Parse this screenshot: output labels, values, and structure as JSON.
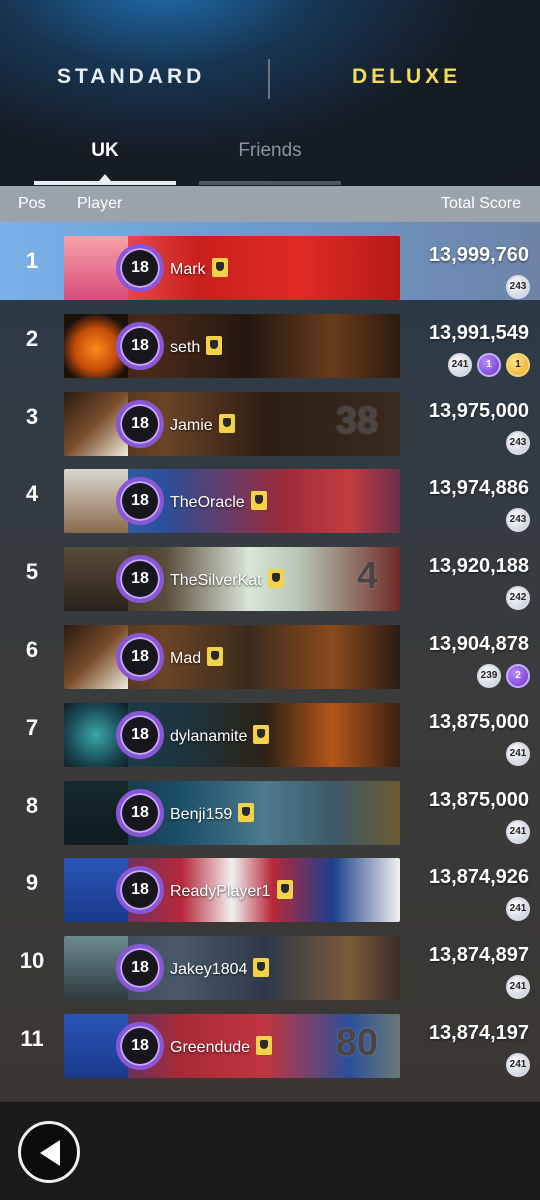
{
  "modes": {
    "standard": "STANDARD",
    "deluxe": "DELUXE"
  },
  "regions": {
    "uk": "UK",
    "friends": "Friends"
  },
  "columns": {
    "pos": "Pos",
    "player": "Player",
    "score": "Total Score"
  },
  "rows": [
    {
      "pos": "1",
      "level": "18",
      "name": "Mark",
      "score": "13,999,760",
      "badges": [
        {
          "v": "243",
          "t": "silver"
        }
      ],
      "highlight": true
    },
    {
      "pos": "2",
      "level": "18",
      "name": "seth",
      "score": "13,991,549",
      "badges": [
        {
          "v": "241",
          "t": "silver"
        },
        {
          "v": "1",
          "t": "purple"
        },
        {
          "v": "1",
          "t": "gold"
        }
      ]
    },
    {
      "pos": "3",
      "level": "18",
      "name": "Jamie",
      "score": "13,975,000",
      "badges": [
        {
          "v": "243",
          "t": "silver"
        }
      ],
      "banner_text": "38"
    },
    {
      "pos": "4",
      "level": "18",
      "name": "TheOracle",
      "score": "13,974,886",
      "badges": [
        {
          "v": "243",
          "t": "silver"
        }
      ]
    },
    {
      "pos": "5",
      "level": "18",
      "name": "TheSilverKat",
      "score": "13,920,188",
      "badges": [
        {
          "v": "242",
          "t": "silver"
        }
      ],
      "banner_text": "4"
    },
    {
      "pos": "6",
      "level": "18",
      "name": "Mad",
      "score": "13,904,878",
      "badges": [
        {
          "v": "239",
          "t": "silver"
        },
        {
          "v": "2",
          "t": "purple"
        }
      ]
    },
    {
      "pos": "7",
      "level": "18",
      "name": "dylanamite",
      "score": "13,875,000",
      "badges": [
        {
          "v": "241",
          "t": "silver"
        }
      ]
    },
    {
      "pos": "8",
      "level": "18",
      "name": "Benji159",
      "score": "13,875,000",
      "badges": [
        {
          "v": "241",
          "t": "silver"
        }
      ]
    },
    {
      "pos": "9",
      "level": "18",
      "name": "ReadyPlayer1",
      "score": "13,874,926",
      "badges": [
        {
          "v": "241",
          "t": "silver"
        }
      ]
    },
    {
      "pos": "10",
      "level": "18",
      "name": "Jakey1804",
      "score": "13,874,897",
      "badges": [
        {
          "v": "241",
          "t": "silver"
        }
      ]
    },
    {
      "pos": "11",
      "level": "18",
      "name": "Greendude",
      "score": "13,874,197",
      "badges": [
        {
          "v": "241",
          "t": "silver"
        }
      ],
      "banner_text": "80"
    }
  ],
  "banner_styles": [
    "linear-gradient(90deg,#e5736f 0%,#e9484c 18%,#c8201c 40%,#e02a26 70%,#b51a17 100%)",
    "linear-gradient(90deg,#2a1a12 0%,#4a2b18 25%,#231711 55%,#6a3b1a 80%,#2a1a12 100%)",
    "linear-gradient(90deg,#3a2516 0%,#6b4426 30%,#2b1e14 60%,#3b2a1e 100%)",
    "linear-gradient(90deg,#3c6fb0 0%,#2b4f9a 30%,#9b2b3b 65%,#c23c40 85%,#6a2f4a 100%)",
    "linear-gradient(90deg,#2e2922 0%,#5a4c3a 30%,#d9e6d8 55%,#b7c6b6 70%,#6e2a24 100%)",
    "linear-gradient(90deg,#3a2416 0%,#6a4426 30%,#3b2b1d 55%,#8a4a1c 80%,#2a1c13 100%)",
    "linear-gradient(90deg,#1f4450 0%,#1c3540 35%,#2d2214 60%,#b5561c 80%,#3a1f10 100%)",
    "linear-gradient(90deg,#152530 0%,#1c4f6a 35%,#4d7a8e 60%,#3c5968 80%,#6a5a34 100%)",
    "linear-gradient(90deg,#1c3f8a 0%,#b8283a 35%,#f0f0f0 50%,#b8283a 62%,#1c3f8a 80%,#f0f0f0 100%)",
    "linear-gradient(90deg,#354250 0%,#4a5868 35%,#2f3848 60%,#7a5a3a 85%,#3a2e25 100%)",
    "linear-gradient(90deg,#1c3f8a 0%,#a92a36 35%,#c03540 60%,#2c4f9a 85%,#6a7a7a 100%)"
  ],
  "avatar_styles": [
    "linear-gradient(180deg,#f6a3a8,#d94b7b)",
    "radial-gradient(circle at 50% 55%,#ff8a1c 0%,#c24c08 45%,#1c120c 75%)",
    "linear-gradient(135deg,#2a1a12,#7a4e2a,#f1ece0)",
    "linear-gradient(180deg,#d9d6cf,#8a6a4c)",
    "linear-gradient(180deg,#5a4c3a,#2a221a)",
    "linear-gradient(135deg,#2a1a12,#7a4e2a,#f1ece0)",
    "radial-gradient(circle,#3aa7a8 0%,#1a4c58 60%,#0e1e24 100%)",
    "linear-gradient(180deg,#162a2f,#0f1b1e)",
    "linear-gradient(180deg,#2a55b8,#1a3a8a)",
    "linear-gradient(180deg,#6c8a90,#2c3a40)",
    "linear-gradient(180deg,#2a55b8,#1a3a8a)"
  ]
}
